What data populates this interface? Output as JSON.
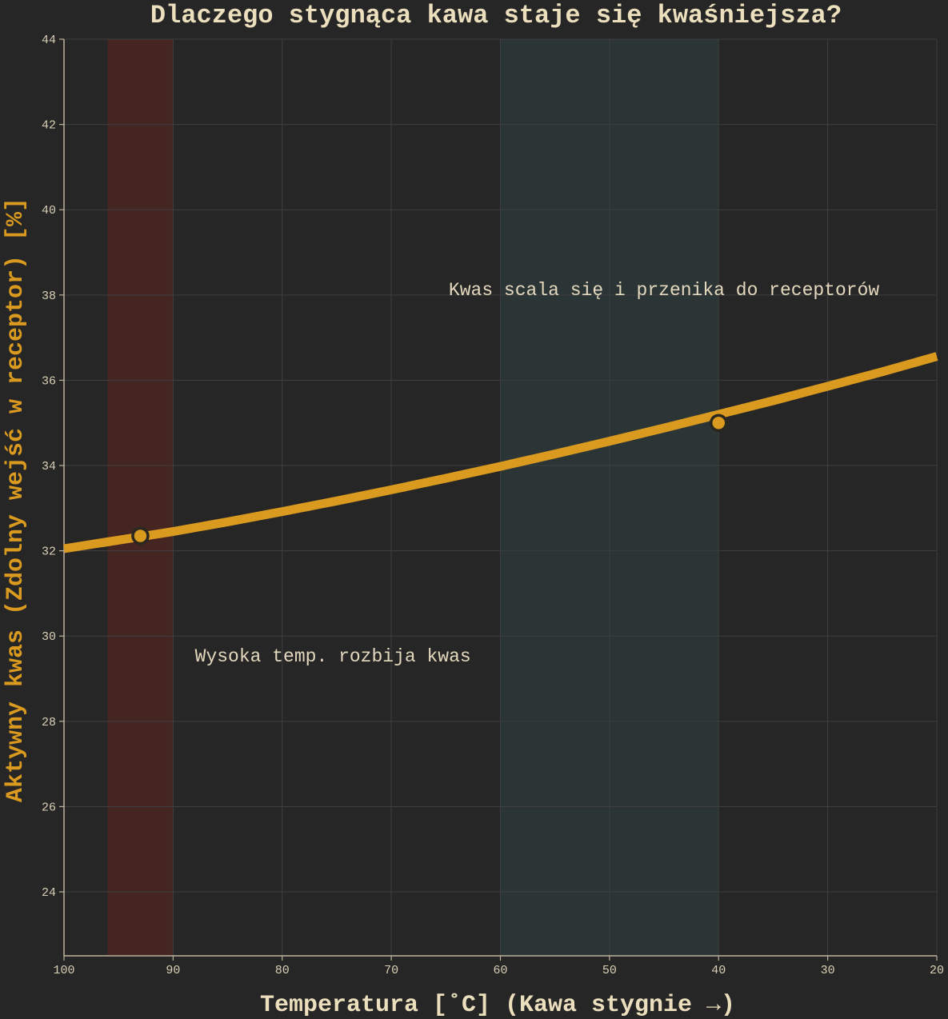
{
  "colors": {
    "background": "#262626",
    "grid": "#3f3f3f",
    "axis": "#bdb29d",
    "tick_text": "#d9cfb6",
    "title_text": "#ecdfbd",
    "ylabel_text": "#d99a1f",
    "xlabel_text": "#ecdfbd",
    "annotation_text": "#e4d9be",
    "line": "#d99a1f",
    "marker_outline": "#2a2620",
    "hot_band": "#452522",
    "cool_band": "#2b3536"
  },
  "chart_data": {
    "type": "line",
    "title": "Dlaczego stygnąca kawa staje się kwaśniejsza?",
    "xlabel": "Temperatura [˚C] (Kawa stygnie →)",
    "ylabel": "Aktywny kwas (Zdolny wejść w receptor) [%]",
    "xlim": [
      100,
      20
    ],
    "ylim": [
      22.5,
      44
    ],
    "x_reversed": true,
    "grid": true,
    "x_ticks": [
      100,
      90,
      80,
      70,
      60,
      50,
      40,
      30,
      20
    ],
    "x_tick_labels": [
      "100",
      "90",
      "80",
      "70",
      "60",
      "50",
      "40",
      "30",
      "20"
    ],
    "y_ticks": [
      24,
      26,
      28,
      30,
      32,
      34,
      36,
      38,
      40,
      42,
      44
    ],
    "y_tick_labels": [
      "24",
      "26",
      "28",
      "30",
      "32",
      "34",
      "36",
      "38",
      "40",
      "42",
      "44"
    ],
    "series": [
      {
        "x": [
          100,
          95,
          90,
          85,
          80,
          75,
          70,
          65,
          60,
          55,
          50,
          45,
          40,
          35,
          30,
          25,
          20
        ],
        "values": [
          32.05,
          32.25,
          32.45,
          32.68,
          32.92,
          33.17,
          33.43,
          33.7,
          33.98,
          34.27,
          34.57,
          34.88,
          35.2,
          35.52,
          35.86,
          36.2,
          36.56
        ]
      }
    ],
    "markers": [
      {
        "x": 93,
        "y": 32.35
      },
      {
        "x": 40,
        "y": 35.0
      }
    ],
    "bands": [
      {
        "x_from": 96,
        "x_to": 90,
        "kind": "hot"
      },
      {
        "x_from": 60,
        "x_to": 40,
        "kind": "cool"
      }
    ],
    "annotations": [
      {
        "text": "Kwas scala się i przenika do receptorów",
        "x": 45,
        "y": 38,
        "anchor": "middle"
      },
      {
        "text": "Wysoka temp. rozbija kwas",
        "x": 88,
        "y": 29.4,
        "anchor": "start"
      }
    ]
  }
}
